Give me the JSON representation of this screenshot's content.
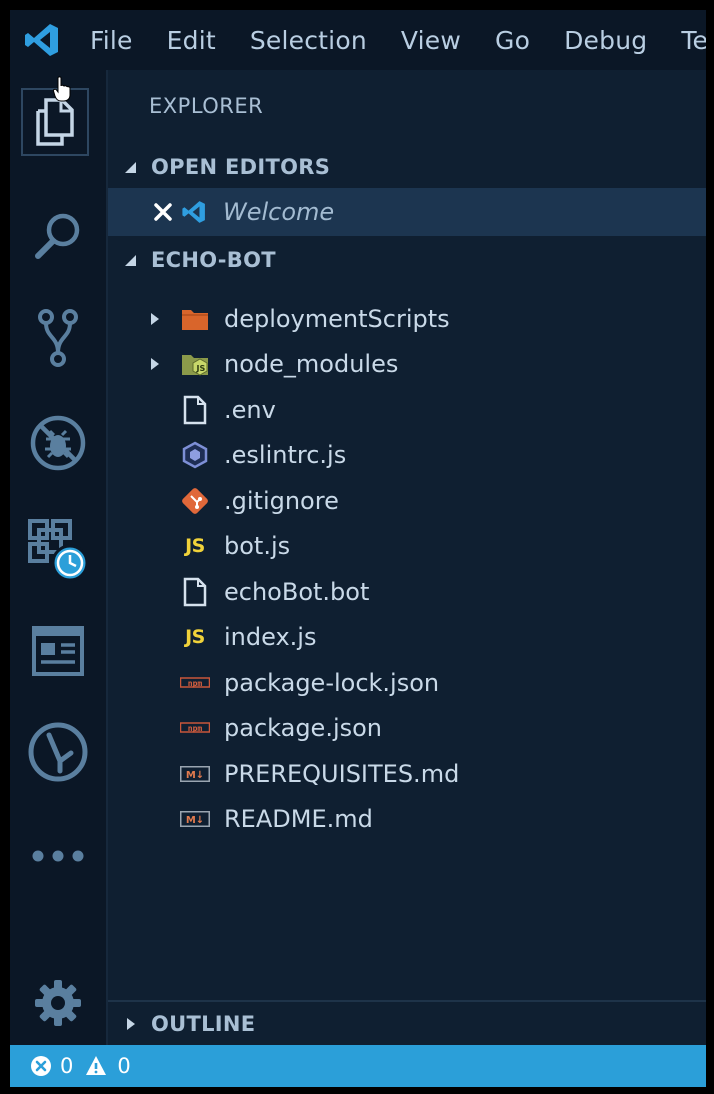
{
  "menubar": {
    "logo_icon": "vscode-logo-icon",
    "items": [
      "File",
      "Edit",
      "Selection",
      "View",
      "Go",
      "Debug",
      "Term"
    ]
  },
  "activitybar": {
    "items": [
      {
        "name": "explorer",
        "icon": "files-icon",
        "active": true
      },
      {
        "name": "search",
        "icon": "search-icon"
      },
      {
        "name": "source-control",
        "icon": "source-control-icon"
      },
      {
        "name": "debug",
        "icon": "no-debug-icon"
      },
      {
        "name": "extensions-history",
        "icon": "extensions-clock-icon"
      },
      {
        "name": "panel",
        "icon": "window-panel-icon"
      },
      {
        "name": "git-graph",
        "icon": "git-graph-icon"
      },
      {
        "name": "more",
        "icon": "ellipsis-icon"
      }
    ],
    "settings_icon": "gear-icon"
  },
  "sidebar": {
    "title": "EXPLORER",
    "open_editors": {
      "header": "OPEN EDITORS",
      "items": [
        {
          "label": "Welcome",
          "icon": "vscode-logo-icon"
        }
      ]
    },
    "project": {
      "header": "ECHO-BOT",
      "items": [
        {
          "label": "deploymentScripts",
          "icon": "folder-icon",
          "folder": true
        },
        {
          "label": "node_modules",
          "icon": "node-folder-icon",
          "folder": true
        },
        {
          "label": ".env",
          "icon": "file-icon"
        },
        {
          "label": ".eslintrc.js",
          "icon": "eslint-icon"
        },
        {
          "label": ".gitignore",
          "icon": "git-icon"
        },
        {
          "label": "bot.js",
          "icon": "js-icon",
          "badge": "JS"
        },
        {
          "label": "echoBot.bot",
          "icon": "file-icon"
        },
        {
          "label": "index.js",
          "icon": "js-icon",
          "badge": "JS"
        },
        {
          "label": "package-lock.json",
          "icon": "npm-icon",
          "badge": "npm"
        },
        {
          "label": "package.json",
          "icon": "npm-icon",
          "badge": "npm"
        },
        {
          "label": "PREREQUISITES.md",
          "icon": "markdown-icon",
          "badge": "M↓"
        },
        {
          "label": "README.md",
          "icon": "markdown-icon",
          "badge": "M↓"
        }
      ]
    },
    "outline": {
      "header": "OUTLINE"
    }
  },
  "statusbar": {
    "errors": "0",
    "warnings": "0"
  },
  "colors": {
    "background": "#0f1f31",
    "activity_bar": "#0b1726",
    "selection": "#1c3550",
    "status_bar": "#2b9fd9",
    "icon_blue": "#5a7f9f",
    "js_yellow": "#f0d23a",
    "folder_orange": "#d9652b"
  }
}
